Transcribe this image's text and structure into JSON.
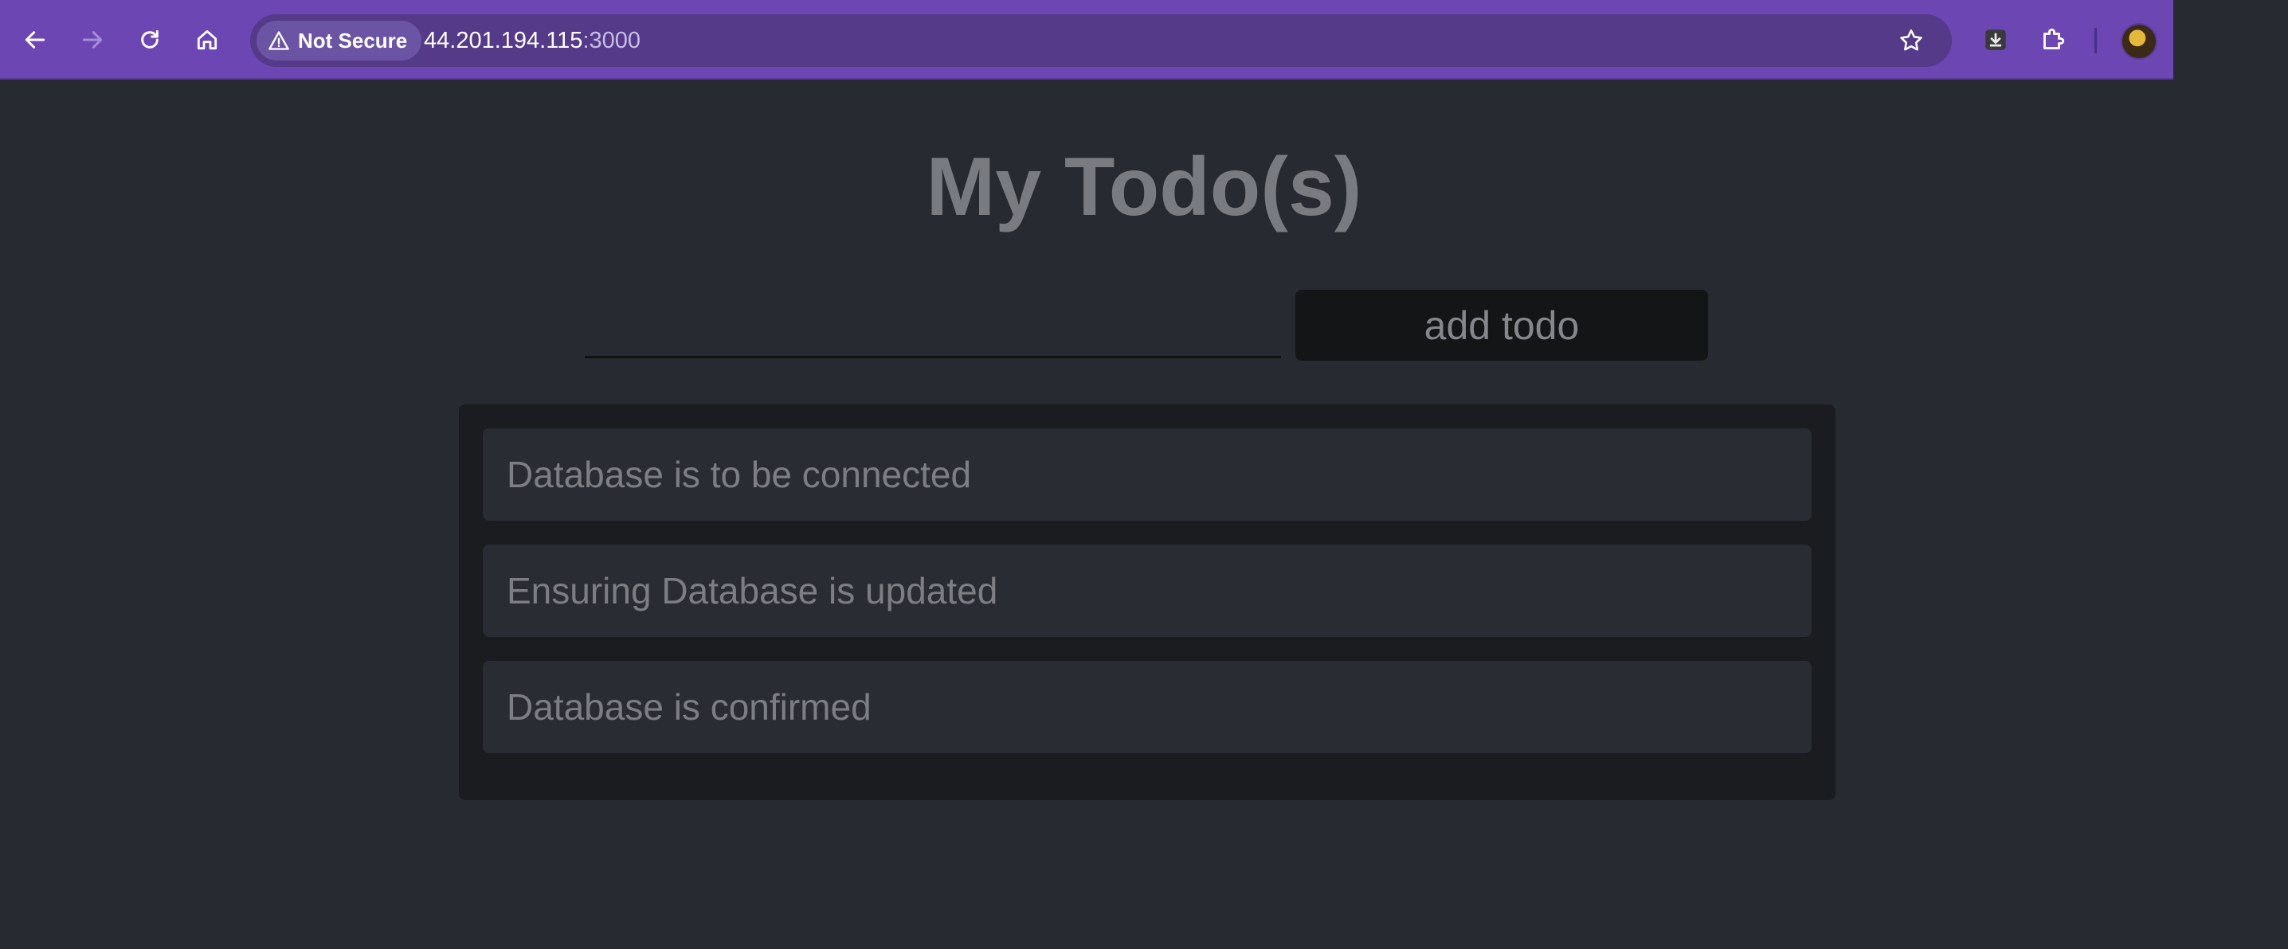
{
  "browser": {
    "security_label": "Not Secure",
    "url_host": "44.201.194.115",
    "url_port": ":3000",
    "accent_color": "#6c46b3"
  },
  "page": {
    "title": "My Todo(s)",
    "input": {
      "value": "",
      "placeholder": ""
    },
    "add_button_label": "add todo",
    "todos": [
      "Database is to be connected",
      "Ensuring Database is updated",
      "Database is confirmed"
    ]
  }
}
